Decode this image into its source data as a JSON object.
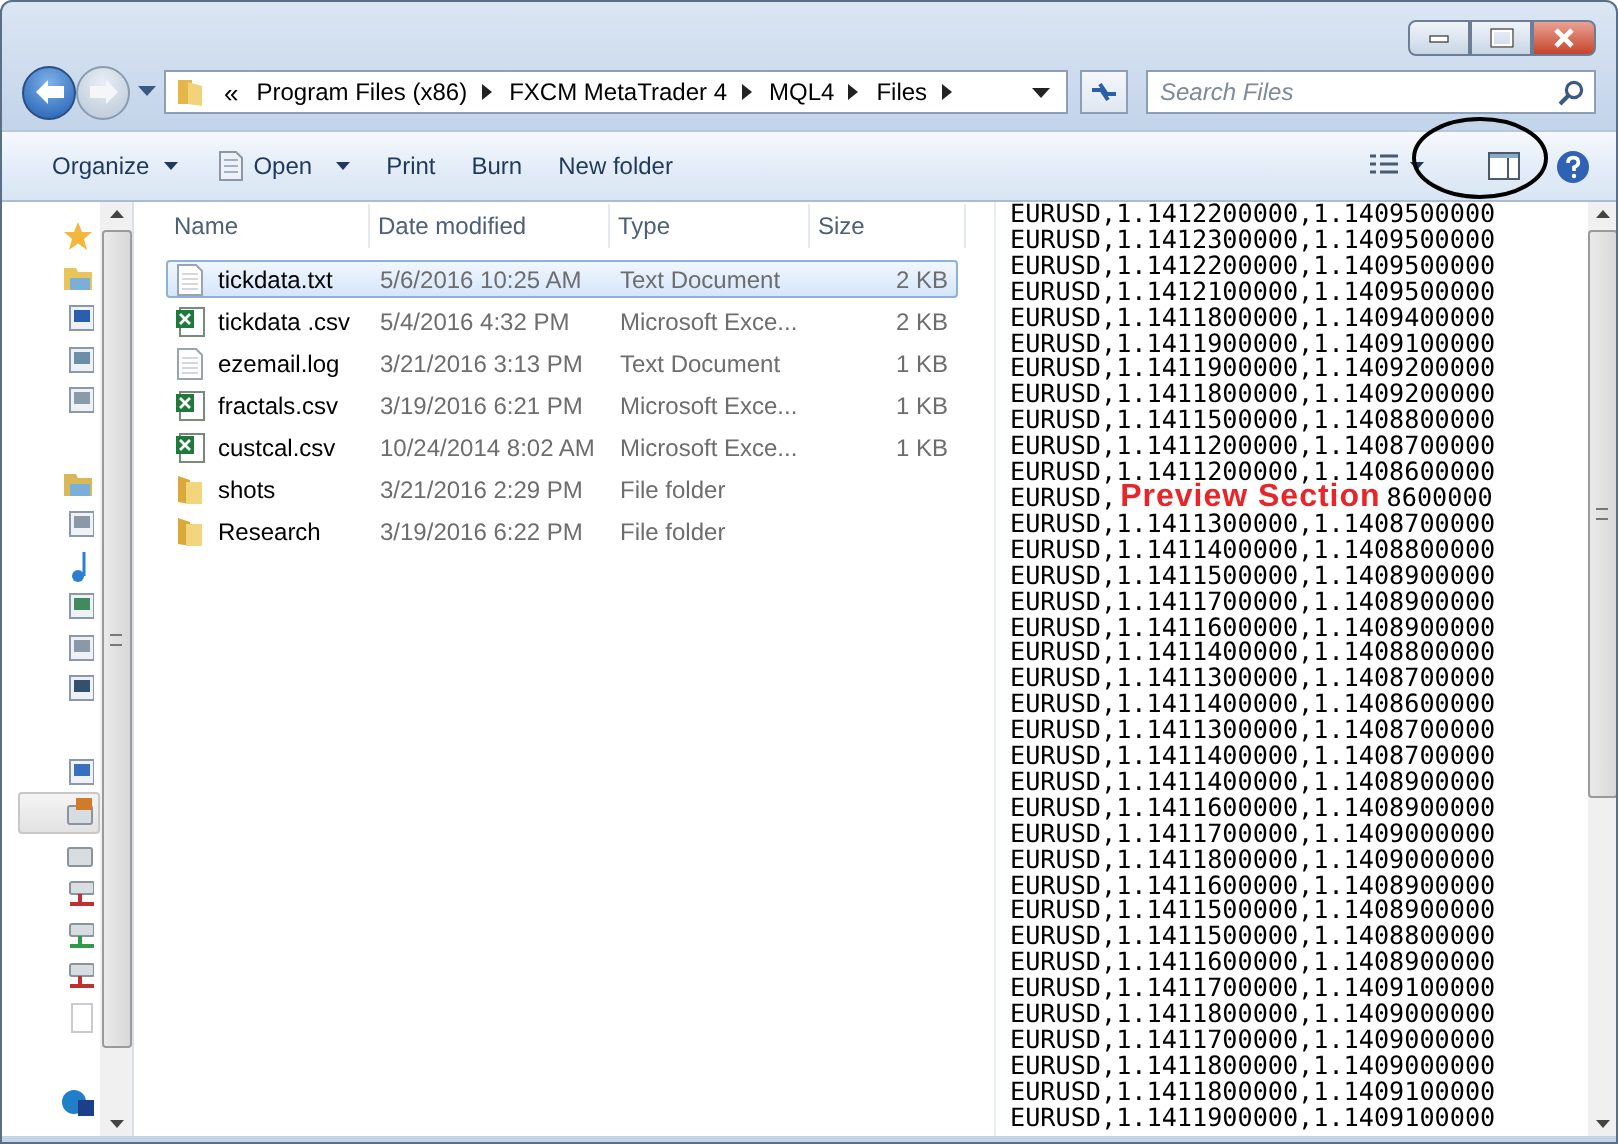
{
  "address": {
    "overflow_glyph": "«",
    "crumbs": [
      "Program Files (x86)",
      "FXCM MetaTrader 4",
      "MQL4",
      "Files"
    ]
  },
  "search": {
    "placeholder": "Search Files"
  },
  "toolbar": {
    "buttons": [
      {
        "label": "Organize",
        "kind": "menu"
      },
      {
        "label": "Open",
        "kind": "open"
      },
      {
        "label": "Print",
        "kind": "plain"
      },
      {
        "label": "Burn",
        "kind": "plain"
      },
      {
        "label": "New folder",
        "kind": "plain"
      }
    ]
  },
  "nav_pane": {
    "groups": [
      [
        {
          "kind": "star",
          "selected": false
        },
        {
          "kind": "folder",
          "selected": false
        },
        {
          "kind": "monitor",
          "selected": false
        },
        {
          "kind": "window",
          "selected": false
        },
        {
          "kind": "places",
          "selected": false
        }
      ],
      [
        {
          "kind": "library",
          "selected": false
        },
        {
          "kind": "document",
          "selected": false
        },
        {
          "kind": "music",
          "selected": false
        },
        {
          "kind": "image",
          "selected": false
        },
        {
          "kind": "document",
          "selected": false
        },
        {
          "kind": "film",
          "selected": false
        }
      ],
      [
        {
          "kind": "computer",
          "selected": false
        },
        {
          "kind": "system-drive",
          "selected": true
        },
        {
          "kind": "drive",
          "selected": false
        },
        {
          "kind": "net-drive-red",
          "selected": false
        },
        {
          "kind": "net-drive-green",
          "selected": false
        },
        {
          "kind": "net-drive-red",
          "selected": false
        },
        {
          "kind": "blank",
          "selected": false
        }
      ],
      [
        {
          "kind": "network",
          "selected": false
        }
      ]
    ]
  },
  "columns": [
    "Name",
    "Date modified",
    "Type",
    "Size"
  ],
  "files": [
    {
      "name": "tickdata.txt",
      "date": "5/6/2016 10:25 AM",
      "type": "Text Document",
      "size": "2 KB",
      "kind": "text",
      "selected": true
    },
    {
      "name": "tickdata .csv",
      "date": "5/4/2016 4:32 PM",
      "type": "Microsoft Exce...",
      "size": "2 KB",
      "kind": "excel",
      "selected": false
    },
    {
      "name": "ezemail.log",
      "date": "3/21/2016 3:13 PM",
      "type": "Text Document",
      "size": "1 KB",
      "kind": "text",
      "selected": false
    },
    {
      "name": "fractals.csv",
      "date": "3/19/2016 6:21 PM",
      "type": "Microsoft Exce...",
      "size": "1 KB",
      "kind": "excel",
      "selected": false
    },
    {
      "name": "custcal.csv",
      "date": "10/24/2014 8:02 AM",
      "type": "Microsoft Exce...",
      "size": "1 KB",
      "kind": "excel",
      "selected": false
    },
    {
      "name": "shots",
      "date": "3/21/2016 2:29 PM",
      "type": "File folder",
      "kind": "folder",
      "selected": false
    },
    {
      "name": "Research",
      "date": "3/19/2016 6:22 PM",
      "type": "File folder",
      "kind": "folder",
      "selected": false
    }
  ],
  "preview": {
    "lines": [
      "EURUSD,1.1412200000,1.1409500000",
      "EURUSD,1.1412300000,1.1409500000",
      "EURUSD,1.1412200000,1.1409500000",
      "EURUSD,1.1412100000,1.1409500000",
      "EURUSD,1.1411800000,1.1409400000",
      "EURUSD,1.1411900000,1.1409100000",
      "EURUSD,1.1411900000,1.1409200000",
      "EURUSD,1.1411800000,1.1409200000",
      "EURUSD,1.1411500000,1.1408800000",
      "EURUSD,1.1411200000,1.1408700000",
      "EURUSD,1.1411200000,1.1408600000",
      {
        "kind": "annotated",
        "before": "EURUSD,",
        "label": "Preview Section",
        "after": "8600000"
      },
      "EURUSD,1.1411300000,1.1408700000",
      "EURUSD,1.1411400000,1.1408800000",
      "EURUSD,1.1411500000,1.1408900000",
      "EURUSD,1.1411700000,1.1408900000",
      "EURUSD,1.1411600000,1.1408900000",
      "EURUSD,1.1411400000,1.1408800000",
      "EURUSD,1.1411300000,1.1408700000",
      "EURUSD,1.1411400000,1.1408600000",
      "EURUSD,1.1411300000,1.1408700000",
      "EURUSD,1.1411400000,1.1408700000",
      "EURUSD,1.1411400000,1.1408900000",
      "EURUSD,1.1411600000,1.1408900000",
      "EURUSD,1.1411700000,1.1409000000",
      "EURUSD,1.1411800000,1.1409000000",
      "EURUSD,1.1411600000,1.1408900000",
      "EURUSD,1.1411500000,1.1408900000",
      "EURUSD,1.1411500000,1.1408800000",
      "EURUSD,1.1411600000,1.1408900000",
      "EURUSD,1.1411700000,1.1409100000",
      "EURUSD,1.1411800000,1.1409000000",
      "EURUSD,1.1411700000,1.1409000000",
      "EURUSD,1.1411800000,1.1409000000",
      "EURUSD,1.1411800000,1.1409100000",
      "EURUSD,1.1411900000,1.1409100000"
    ]
  }
}
